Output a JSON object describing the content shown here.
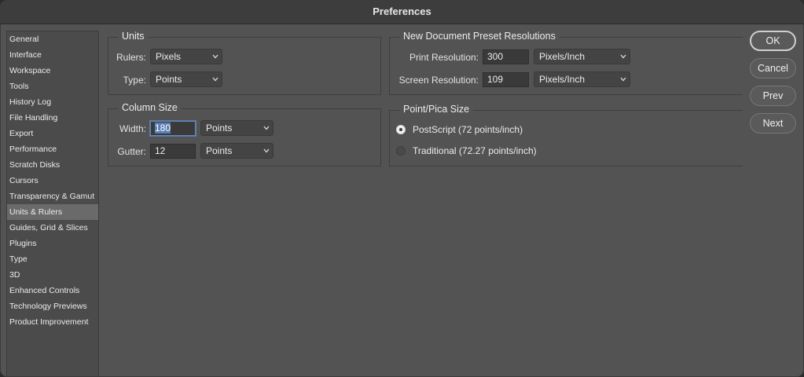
{
  "window": {
    "title": "Preferences"
  },
  "sidebar": {
    "items": [
      {
        "label": "General"
      },
      {
        "label": "Interface"
      },
      {
        "label": "Workspace"
      },
      {
        "label": "Tools"
      },
      {
        "label": "History Log"
      },
      {
        "label": "File Handling"
      },
      {
        "label": "Export"
      },
      {
        "label": "Performance"
      },
      {
        "label": "Scratch Disks"
      },
      {
        "label": "Cursors"
      },
      {
        "label": "Transparency & Gamut"
      },
      {
        "label": "Units & Rulers"
      },
      {
        "label": "Guides, Grid & Slices"
      },
      {
        "label": "Plugins"
      },
      {
        "label": "Type"
      },
      {
        "label": "3D"
      },
      {
        "label": "Enhanced Controls"
      },
      {
        "label": "Technology Previews"
      },
      {
        "label": "Product Improvement"
      }
    ],
    "selected": "Units & Rulers"
  },
  "units": {
    "title": "Units",
    "rulers_label": "Rulers:",
    "rulers_value": "Pixels",
    "type_label": "Type:",
    "type_value": "Points"
  },
  "column_size": {
    "title": "Column Size",
    "width_label": "Width:",
    "width_value": "180",
    "width_unit": "Points",
    "gutter_label": "Gutter:",
    "gutter_value": "12",
    "gutter_unit": "Points"
  },
  "resolutions": {
    "title": "New Document Preset Resolutions",
    "print_label": "Print Resolution:",
    "print_value": "300",
    "print_unit": "Pixels/Inch",
    "screen_label": "Screen Resolution:",
    "screen_value": "109",
    "screen_unit": "Pixels/Inch"
  },
  "pica": {
    "title": "Point/Pica Size",
    "options": [
      {
        "label": "PostScript (72 points/inch)",
        "selected": true
      },
      {
        "label": "Traditional (72.27 points/inch)",
        "selected": false
      }
    ]
  },
  "buttons": {
    "ok": "OK",
    "cancel": "Cancel",
    "prev": "Prev",
    "next": "Next"
  }
}
